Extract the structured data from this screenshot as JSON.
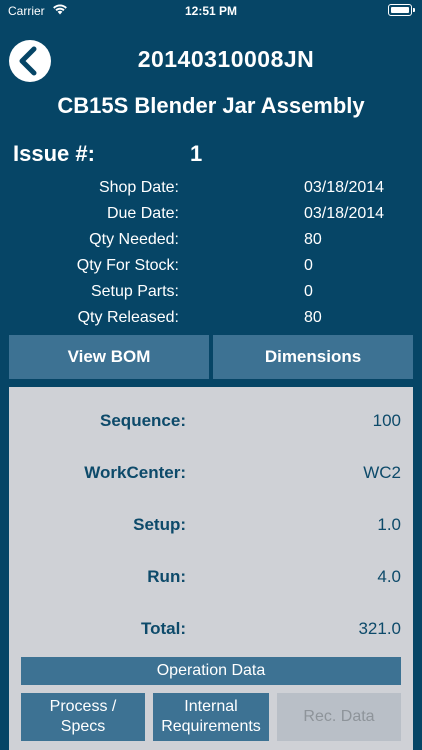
{
  "status_bar": {
    "carrier": "Carrier",
    "time": "12:51 PM"
  },
  "header": {
    "order_number": "20140310008JN",
    "part_title": "CB15S Blender Jar Assembly",
    "issue_label": "Issue #:",
    "issue_value": "1"
  },
  "details": [
    {
      "label": "Shop Date:",
      "value": "03/18/2014"
    },
    {
      "label": "Due Date:",
      "value": "03/18/2014"
    },
    {
      "label": "Qty Needed:",
      "value": "80"
    },
    {
      "label": "Qty For Stock:",
      "value": "0"
    },
    {
      "label": "Setup Parts:",
      "value": "0"
    },
    {
      "label": "Qty Released:",
      "value": "80"
    }
  ],
  "buttons": {
    "view_bom": "View BOM",
    "dimensions": "Dimensions"
  },
  "operation": [
    {
      "label": "Sequence:",
      "value": "100"
    },
    {
      "label": "WorkCenter:",
      "value": "WC2"
    },
    {
      "label": "Setup:",
      "value": "1.0"
    },
    {
      "label": "Run:",
      "value": "4.0"
    },
    {
      "label": "Total:",
      "value": "321.0"
    }
  ],
  "operation_data_label": "Operation Data",
  "bottom_buttons": {
    "process_line1": "Process /",
    "process_line2": "Specs",
    "internal_line1": "Internal",
    "internal_line2": "Requirements",
    "rec_data": "Rec. Data"
  },
  "colors": {
    "background": "#064566",
    "button": "#3d7293",
    "panel": "#cfd1d6",
    "panel_text": "#0d4a6a",
    "disabled_button": "#b9bfc7"
  }
}
